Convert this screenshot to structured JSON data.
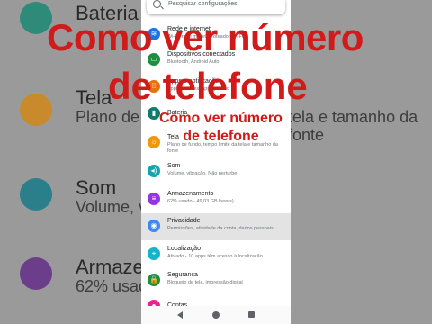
{
  "overlay": {
    "headline_line1": "Como ver número",
    "headline_line2": "de telefone",
    "small_line1": "Como ver número",
    "small_line2": "de telefone"
  },
  "background": {
    "rows": [
      {
        "title": "Bateria",
        "sub": "",
        "right": "",
        "color": "#2e8b7a"
      },
      {
        "title": "Tela",
        "sub": "Plano de",
        "right": "tela e tamanho da fonte",
        "color": "#c88a2a"
      },
      {
        "title": "Som",
        "sub": "Volume, v",
        "right": "",
        "color": "#2b7f8a"
      },
      {
        "title": "Armazen",
        "sub": "62% usad",
        "right": "",
        "color": "#6b3d8a"
      }
    ]
  },
  "search": {
    "placeholder": "Pesquisar configurações"
  },
  "settings": [
    {
      "title": "Rede e internet",
      "sub": "Wi-Fi, rede móvel e roteador Wi-Fi",
      "color": "#1a73e8",
      "icon": "wifi-icon",
      "glyph": "≋"
    },
    {
      "title": "Dispositivos conectados",
      "sub": "Bluetooth, Android Auto",
      "color": "#1e8e3e",
      "icon": "devices-icon",
      "glyph": "▭"
    },
    {
      "title": "Apps e notificações",
      "sub": "Apps recentes, apps padrão",
      "color": "#e8710a",
      "icon": "apps-icon",
      "glyph": "⁞⁞"
    },
    {
      "title": "Bateria",
      "sub": "",
      "color": "#0f7b6c",
      "icon": "battery-icon",
      "glyph": "▮"
    },
    {
      "title": "Tela",
      "sub": "Plano de fundo, tempo limite da tela e tamanho da fonte",
      "color": "#f29900",
      "icon": "display-icon",
      "glyph": "☼"
    },
    {
      "title": "Som",
      "sub": "Volume, vibração, Não perturbe",
      "color": "#12a4af",
      "icon": "sound-icon",
      "glyph": "◂)"
    },
    {
      "title": "Armazenamento",
      "sub": "62% usado - 49,03 GB livre(s)",
      "color": "#9334e6",
      "icon": "storage-icon",
      "glyph": "≡"
    },
    {
      "title": "Privacidade",
      "sub": "Permissões, atividade da conta, dados pessoais",
      "color": "#4285f4",
      "icon": "privacy-icon",
      "glyph": "◉"
    },
    {
      "title": "Localização",
      "sub": "Ativado - 10 apps têm acesso à localização",
      "color": "#12b5cb",
      "icon": "location-icon",
      "glyph": "⌖"
    },
    {
      "title": "Segurança",
      "sub": "Bloqueio de tela, impressão digital",
      "color": "#1e8e3e",
      "icon": "lock-icon",
      "glyph": "🔒"
    },
    {
      "title": "Contas",
      "sub": "",
      "color": "#e52592",
      "icon": "account-icon",
      "glyph": "●"
    }
  ]
}
